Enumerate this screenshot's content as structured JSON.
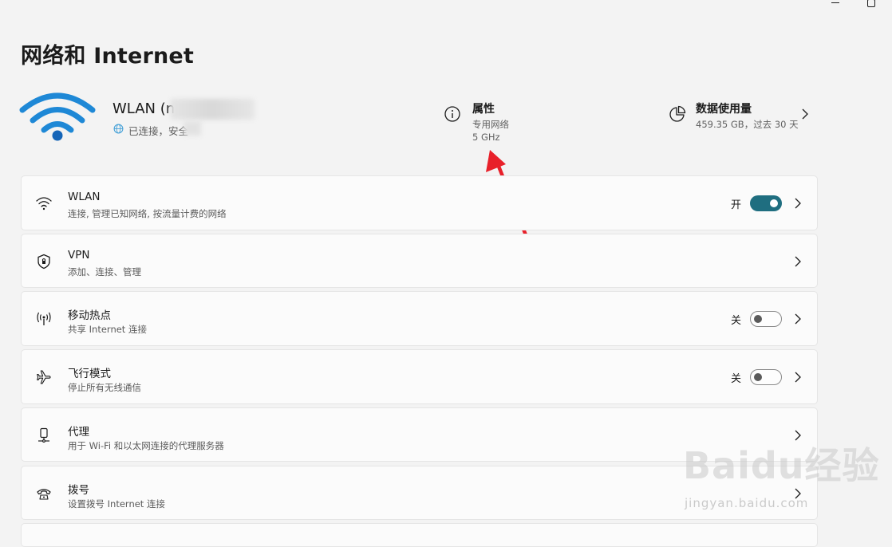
{
  "header": {
    "title": "网络和 Internet"
  },
  "connection": {
    "name": "WLAN (n",
    "status": "已连接，安全"
  },
  "properties": {
    "title": "属性",
    "network_type": "专用网络",
    "band": "5 GHz"
  },
  "data_usage": {
    "title": "数据使用量",
    "summary": "459.35 GB，过去 30 天"
  },
  "settings": [
    {
      "title": "WLAN",
      "subtitle": "连接, 管理已知网络, 按流量计费的网络",
      "icon": "wifi-icon",
      "toggle_label": "开",
      "toggle_on": true
    },
    {
      "title": "VPN",
      "subtitle": "添加、连接、管理",
      "icon": "shield-icon"
    },
    {
      "title": "移动热点",
      "subtitle": "共享 Internet 连接",
      "icon": "hotspot-icon",
      "toggle_label": "关",
      "toggle_on": false
    },
    {
      "title": "飞行模式",
      "subtitle": "停止所有无线通信",
      "icon": "airplane-icon",
      "toggle_label": "关",
      "toggle_on": false
    },
    {
      "title": "代理",
      "subtitle": "用于 Wi-Fi 和以太网连接的代理服务器",
      "icon": "proxy-icon"
    },
    {
      "title": "拨号",
      "subtitle": "设置拨号 Internet 连接",
      "icon": "dialup-icon"
    }
  ],
  "watermark": {
    "logo": "Baidu经验",
    "url": "jingyan.baidu.com"
  },
  "colors": {
    "accent": "#1f6e80",
    "wifi_blue": "#1e88d6",
    "annotation_red": "#e8202a"
  }
}
